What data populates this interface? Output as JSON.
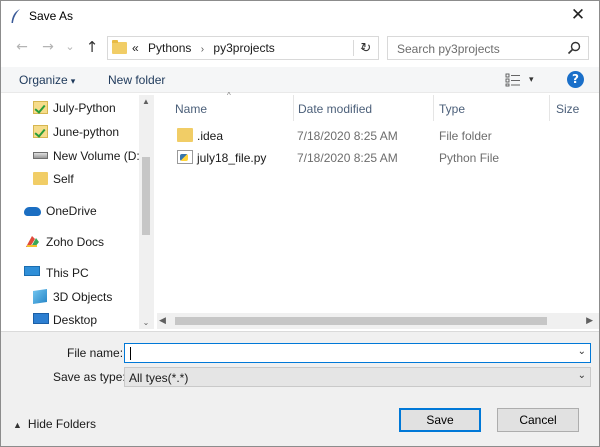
{
  "window": {
    "title": "Save As",
    "close_glyph": "✕"
  },
  "nav": {
    "back_glyph": "←",
    "forward_glyph": "→",
    "recent_glyph": "⌄",
    "up_glyph": "↑",
    "breadcrumb_overflow": "«",
    "breadcrumb": [
      "Pythons",
      "py3projects"
    ],
    "breadcrumb_sep": "›",
    "dropdown_glyph": "⌄",
    "refresh_glyph": "↻",
    "search_placeholder": "Search py3projects"
  },
  "toolbar": {
    "organize_label": "Organize",
    "organize_caret": "▾",
    "new_folder_label": "New folder",
    "view_caret": "▾",
    "help_glyph": "?"
  },
  "sidebar": {
    "items": [
      {
        "label": "July-Python",
        "icon": "checked-folder-icon"
      },
      {
        "label": "June-python",
        "icon": "checked-folder-icon"
      },
      {
        "label": "New Volume (D:",
        "icon": "drive-icon"
      },
      {
        "label": "Self",
        "icon": "folder-icon"
      },
      {
        "label": "OneDrive",
        "icon": "onedrive-cloud-icon"
      },
      {
        "label": "Zoho Docs",
        "icon": "zoho-docs-icon"
      },
      {
        "label": "This PC",
        "icon": "computer-icon"
      },
      {
        "label": "3D Objects",
        "icon": "3d-objects-icon"
      },
      {
        "label": "Desktop",
        "icon": "desktop-icon"
      }
    ],
    "scroll_up_glyph": "▲",
    "scroll_down_glyph": "▼",
    "expand_glyph": "⌄"
  },
  "files": {
    "columns": [
      "Name",
      "Date modified",
      "Type",
      "Size"
    ],
    "sort_glyph": "^",
    "rows": [
      {
        "name": ".idea",
        "date": "7/18/2020 8:25 AM",
        "type": "File folder",
        "icon": "folder-icon"
      },
      {
        "name": "july18_file.py",
        "date": "7/18/2020 8:25 AM",
        "type": "Python File",
        "icon": "python-file-icon"
      }
    ],
    "hscroll_left_glyph": "◀",
    "hscroll_right_glyph": "▶"
  },
  "form": {
    "filename_label": "File name:",
    "filename_value": "",
    "savetype_label": "Save as type:",
    "savetype_value": "All tyes(*.*)",
    "dropdown_glyph": "⌄",
    "hide_folders_label": "Hide Folders",
    "hide_folders_caret": "▲",
    "save_label": "Save",
    "cancel_label": "Cancel"
  },
  "colors": {
    "accent": "#0078d7",
    "link": "#1e395b",
    "folder": "#f1cd66"
  }
}
